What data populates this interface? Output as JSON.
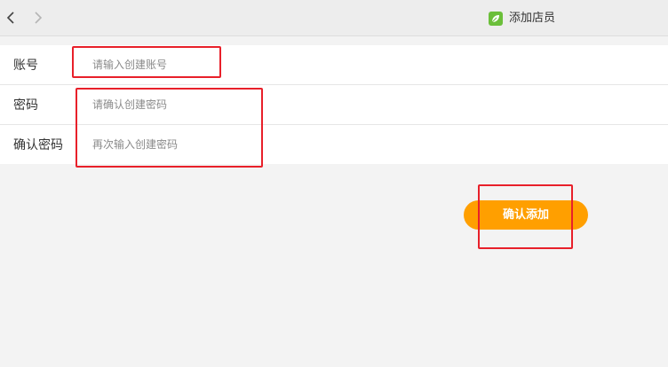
{
  "window": {
    "title": "添加店员",
    "icon": "leaf-app-icon"
  },
  "nav": {
    "back_icon": "chevron-left-icon",
    "forward_icon": "chevron-right-icon"
  },
  "form": {
    "fields": [
      {
        "label": "账号",
        "placeholder": "请输入创建账号",
        "value": ""
      },
      {
        "label": "密码",
        "placeholder": "请确认创建密码",
        "value": ""
      },
      {
        "label": "确认密码",
        "placeholder": "再次输入创建密码",
        "value": ""
      }
    ]
  },
  "actions": {
    "confirm_label": "确认添加"
  },
  "colors": {
    "accent": "#ff9f00",
    "highlight": "#e8202a",
    "app_icon": "#6bbf3a"
  }
}
